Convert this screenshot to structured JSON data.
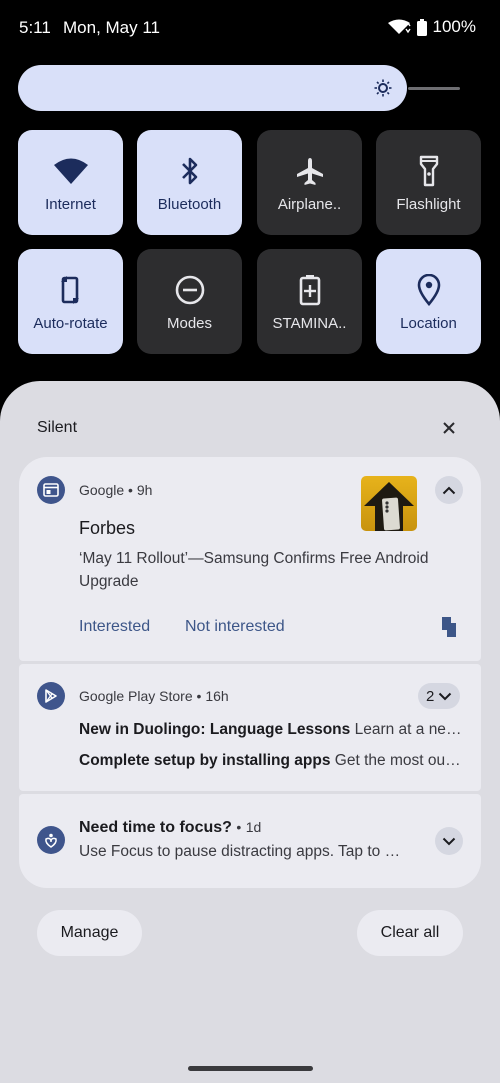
{
  "status": {
    "time": "5:11",
    "date": "Mon, May 11",
    "battery": "100%"
  },
  "tiles": [
    {
      "label": "Internet",
      "icon": "wifi-icon",
      "state": "on"
    },
    {
      "label": "Bluetooth",
      "icon": "bluetooth-icon",
      "state": "on"
    },
    {
      "label": "Airplane..",
      "icon": "airplane-icon",
      "state": "off"
    },
    {
      "label": "Flashlight",
      "icon": "flashlight-icon",
      "state": "off"
    },
    {
      "label": "Auto-rotate",
      "icon": "rotate-icon",
      "state": "on"
    },
    {
      "label": "Modes",
      "icon": "modes-icon",
      "state": "off"
    },
    {
      "label": "STAMINA..",
      "icon": "battery-plus-icon",
      "state": "off"
    },
    {
      "label": "Location",
      "icon": "location-pin-icon",
      "state": "on"
    }
  ],
  "brightness": {
    "level": 0.88
  },
  "shade": {
    "section_label": "Silent",
    "notifications": [
      {
        "app": "Google",
        "sep": "•",
        "time": "9h",
        "title": "Forbes",
        "text": "‘May 11 Rollout’—Samsung Confirms Free Android Upgrade",
        "actions": [
          "Interested",
          "Not interested"
        ]
      },
      {
        "app": "Google Play Store",
        "sep": "•",
        "time": "16h",
        "count": "2",
        "lines": [
          {
            "title": "New in Duolingo: Language Lessons",
            "text": "Learn at a new…"
          },
          {
            "title": "Complete setup by installing apps",
            "text": "Get the most out…"
          }
        ]
      },
      {
        "title": "Need time to focus?",
        "sep": "•",
        "time": "1d",
        "text": "Use Focus to pause distracting apps. Tap to …"
      }
    ],
    "manage_label": "Manage",
    "clear_label": "Clear all"
  },
  "colors": {
    "tile_on": "#d9e0f9",
    "tile_off": "#2d2d2f",
    "accent": "#3d5688",
    "shade": "#dcdce2"
  }
}
